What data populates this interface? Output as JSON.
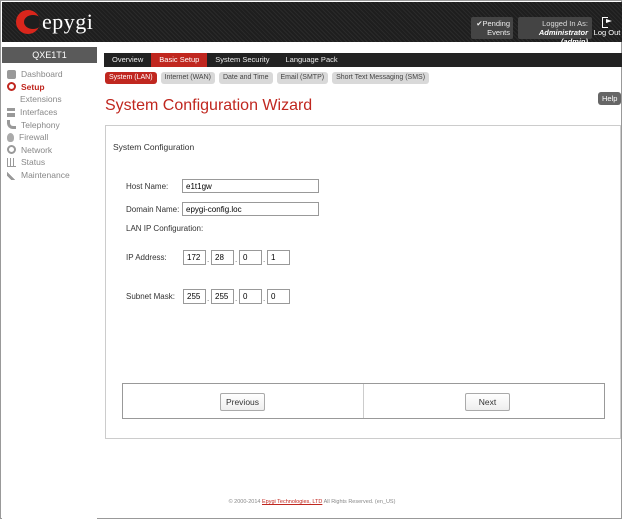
{
  "header": {
    "logo_text": "epygi",
    "pending_line1": "✔Pending",
    "pending_line2": "Events",
    "logged_in_label": "Logged In As:",
    "logged_in_user": "Administrator (admin)",
    "logout_label": "Log Out"
  },
  "sidebar": {
    "device_name": "QXE1T1",
    "items": [
      {
        "label": "Dashboard",
        "icon": "dashboard-icon"
      },
      {
        "label": "Setup",
        "icon": "gear-icon"
      },
      {
        "label": "Extensions",
        "icon": "extensions-icon"
      },
      {
        "label": "Interfaces",
        "icon": "interfaces-icon"
      },
      {
        "label": "Telephony",
        "icon": "phone-icon"
      },
      {
        "label": "Firewall",
        "icon": "fire-icon"
      },
      {
        "label": "Network",
        "icon": "globe-icon"
      },
      {
        "label": "Status",
        "icon": "chart-icon"
      },
      {
        "label": "Maintenance",
        "icon": "wrench-icon"
      }
    ]
  },
  "tabs": [
    "Overview",
    "Basic Setup",
    "System Security",
    "Language Pack"
  ],
  "subtabs": [
    "System (LAN)",
    "Internet (WAN)",
    "Date and Time",
    "Email (SMTP)",
    "Short Text Messaging (SMS)"
  ],
  "help_label": "Help",
  "page_title": "System Configuration Wizard",
  "form": {
    "section_title": "System Configuration",
    "host_name_label": "Host Name:",
    "host_name_value": "e1t1gw",
    "domain_name_label": "Domain Name:",
    "domain_name_value": "epygi-config.loc",
    "lan_ip_label": "LAN IP Configuration:",
    "ip_address_label": "IP Address:",
    "ip_address": [
      "172",
      "28",
      "0",
      "1"
    ],
    "subnet_mask_label": "Subnet Mask:",
    "subnet_mask": [
      "255",
      "255",
      "0",
      "0"
    ]
  },
  "nav": {
    "previous_label": "Previous",
    "next_label": "Next"
  },
  "footer": {
    "prefix": "© 2000-2014",
    "company": "Epygi Technologies, LTD",
    "suffix": "All Rights Reserved. (en_US)"
  },
  "colors": {
    "accent": "#c0271f",
    "header_bg": "#1e1e1e",
    "tab_bar_bg": "#222222"
  }
}
